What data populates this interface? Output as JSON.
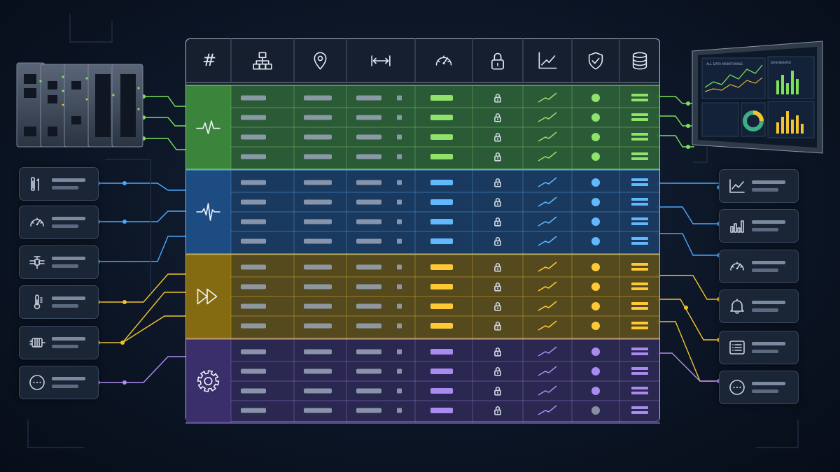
{
  "table": {
    "columns": [
      {
        "key": "index",
        "icon": "hash-icon",
        "header": "#"
      },
      {
        "key": "topology",
        "icon": "network-topology-icon"
      },
      {
        "key": "location",
        "icon": "location-pin-icon"
      },
      {
        "key": "range",
        "icon": "distance-arrows-icon"
      },
      {
        "key": "performance",
        "icon": "gauge-icon"
      },
      {
        "key": "security",
        "icon": "padlock-icon"
      },
      {
        "key": "trend",
        "icon": "trend-line-icon"
      },
      {
        "key": "protection",
        "icon": "shield-check-icon"
      },
      {
        "key": "storage",
        "icon": "database-icon"
      }
    ],
    "groups": [
      {
        "name": "group-signal",
        "icon": "heartbeat-signal-icon",
        "color": "#3c8a3c",
        "accent": "#8fe26a",
        "rows": 4
      },
      {
        "name": "group-waveform",
        "icon": "waveform-icon",
        "color": "#1d4f86",
        "accent": "#62b8ff",
        "rows": 4
      },
      {
        "name": "group-forward",
        "icon": "fast-forward-icon",
        "color": "#8a6e10",
        "accent": "#ffc935",
        "rows": 4
      },
      {
        "name": "group-settings",
        "icon": "gear-icon",
        "color": "#3c2f6e",
        "accent": "#a98bf0",
        "rows": 4
      }
    ]
  },
  "left_panel": {
    "hardware": "network-switch-rack",
    "sensors": [
      {
        "icon": "level-sensor-icon"
      },
      {
        "icon": "gauge-icon"
      },
      {
        "icon": "valve-icon"
      },
      {
        "icon": "thermometer-icon"
      },
      {
        "icon": "motor-icon"
      },
      {
        "icon": "more-options-icon"
      }
    ]
  },
  "right_panel": {
    "monitor": {
      "title": "ALL DATA MONITORING",
      "panel_label": "DASHBOARD"
    },
    "outputs": [
      {
        "icon": "line-chart-icon"
      },
      {
        "icon": "bar-chart-icon"
      },
      {
        "icon": "gauge-icon"
      },
      {
        "icon": "bell-icon"
      },
      {
        "icon": "list-icon"
      },
      {
        "icon": "more-options-icon"
      }
    ]
  }
}
